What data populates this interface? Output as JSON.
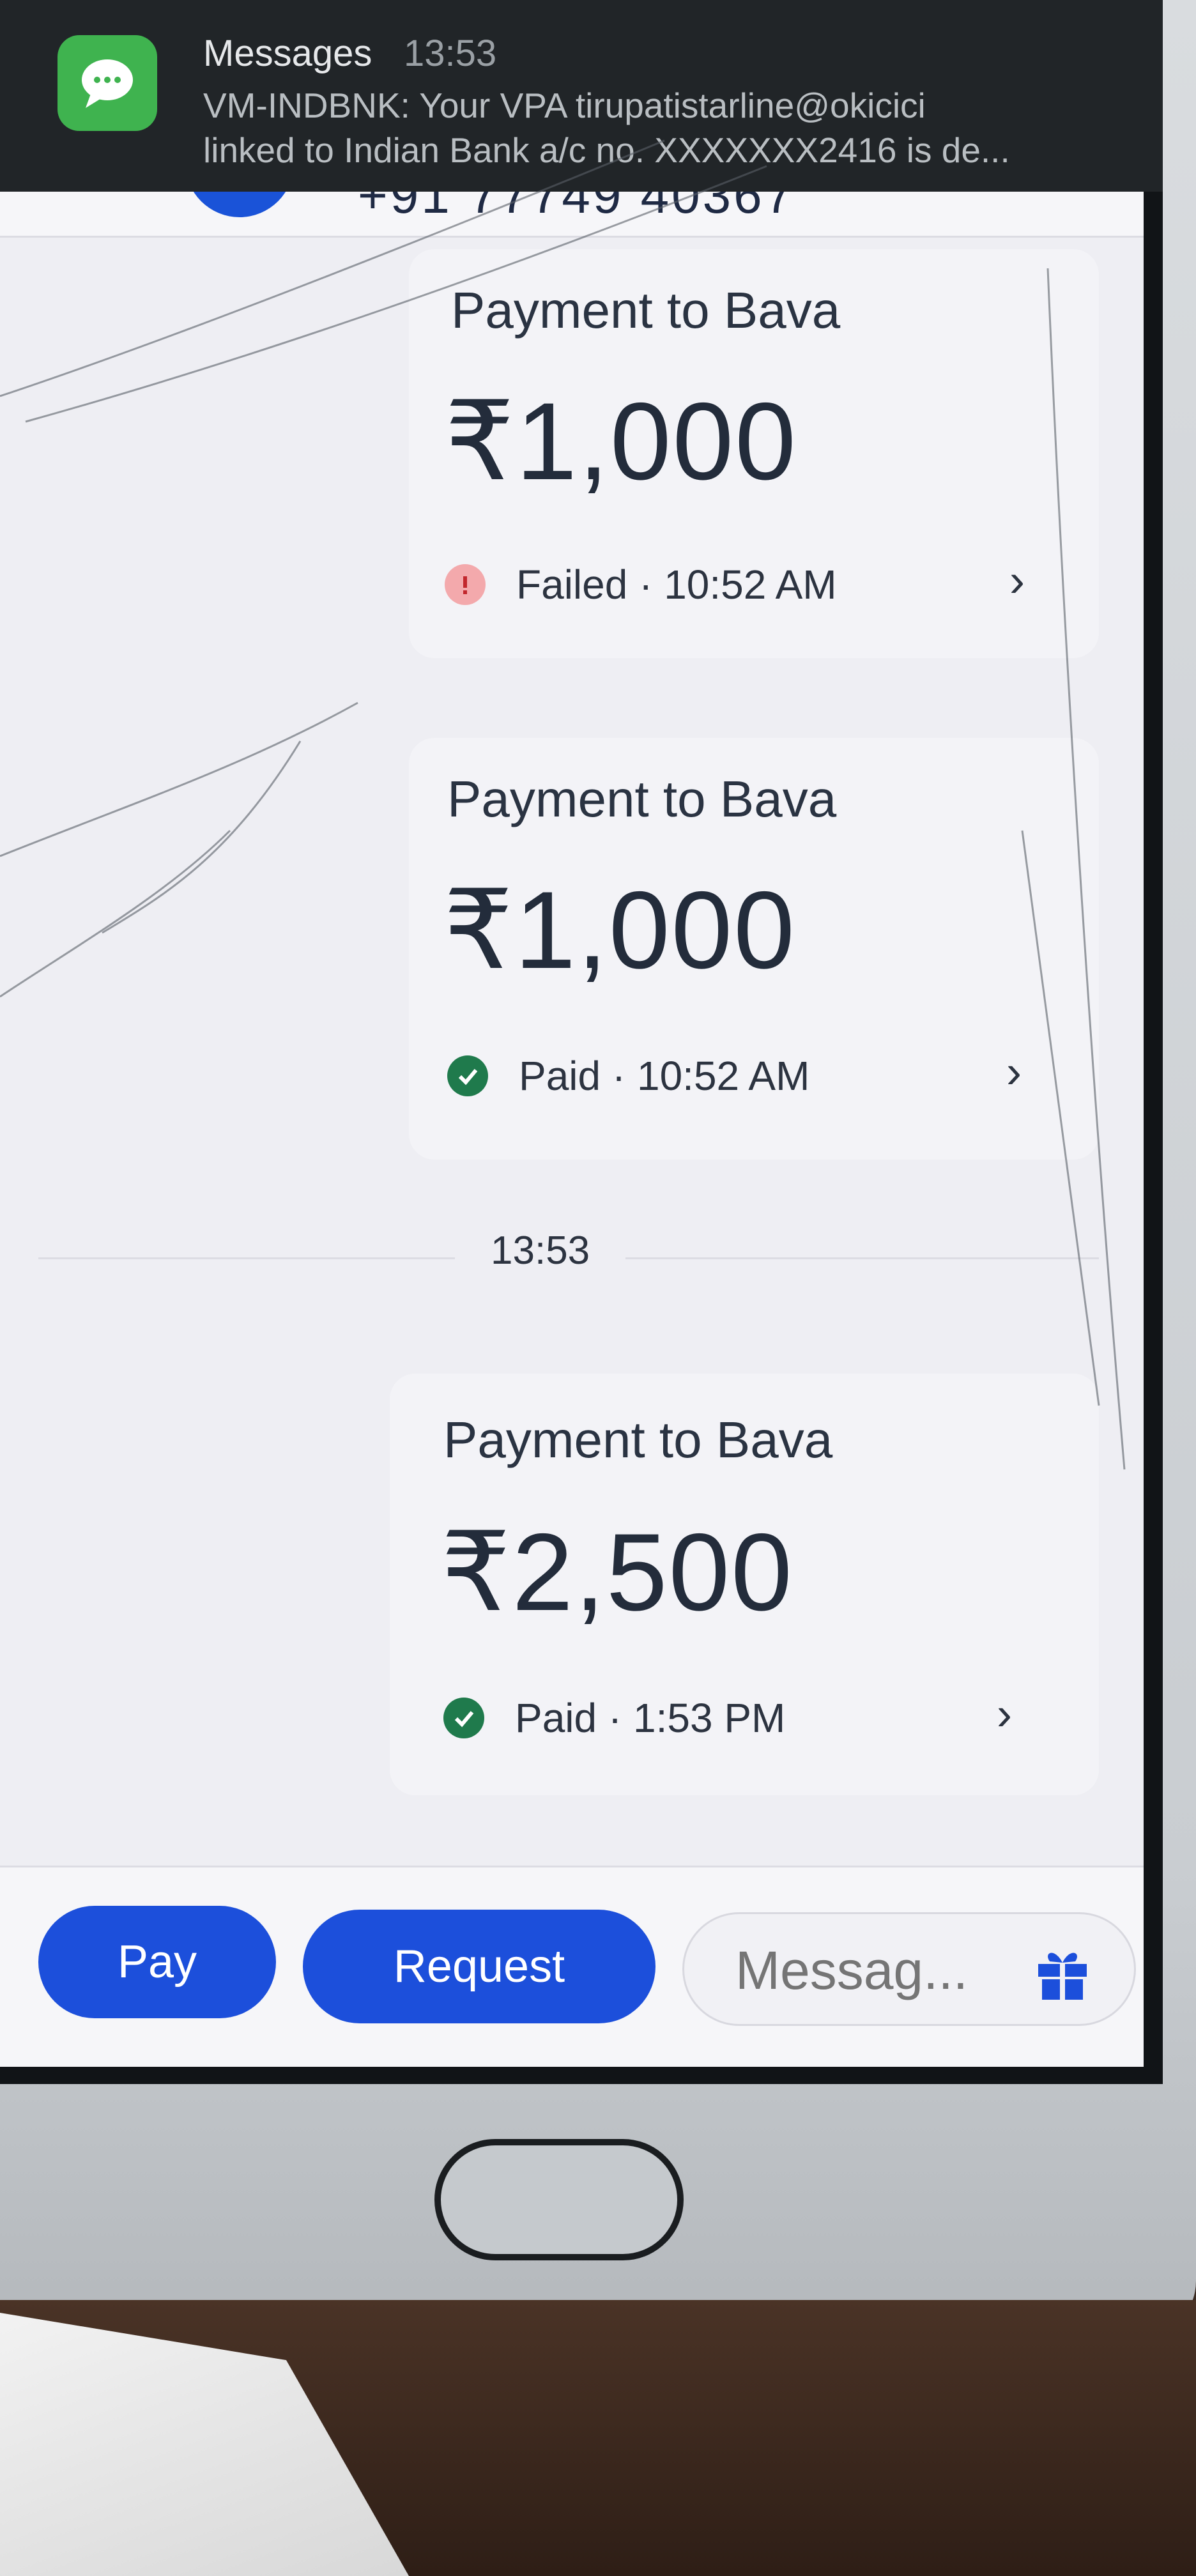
{
  "notification": {
    "app_name": "Messages",
    "time": "13:53",
    "line1": "VM-INDBNK: Your VPA tirupatistarline@okicici",
    "line2": "linked to Indian Bank a/c no. XXXXXXX2416 is de..."
  },
  "header": {
    "phone_fragment": "+91 77749 40367"
  },
  "transactions": [
    {
      "title": "Payment to Bava",
      "amount": "₹1,000",
      "status": "Failed · 10:52 AM",
      "status_type": "failed"
    },
    {
      "title": "Payment to Bava",
      "amount": "₹1,000",
      "status": "Paid · 10:52 AM",
      "status_type": "paid"
    },
    {
      "title": "Payment to Bava",
      "amount": "₹2,500",
      "status": "Paid · 1:53 PM",
      "status_type": "paid"
    }
  ],
  "date_divider": "13:53",
  "actions": {
    "pay_label": "Pay",
    "request_label": "Request",
    "message_placeholder": "Messag..."
  },
  "icons": {
    "notification_app": "chat-bubble-icon",
    "failed_status": "error-circle-icon",
    "paid_status": "check-circle-icon",
    "open_details": "chevron-right-icon",
    "gift": "gift-icon"
  },
  "colors": {
    "accent": "#1c4fdb",
    "paid": "#1f7a4c",
    "failed": "#f3a9ac",
    "messages_icon": "#3fb34f"
  }
}
